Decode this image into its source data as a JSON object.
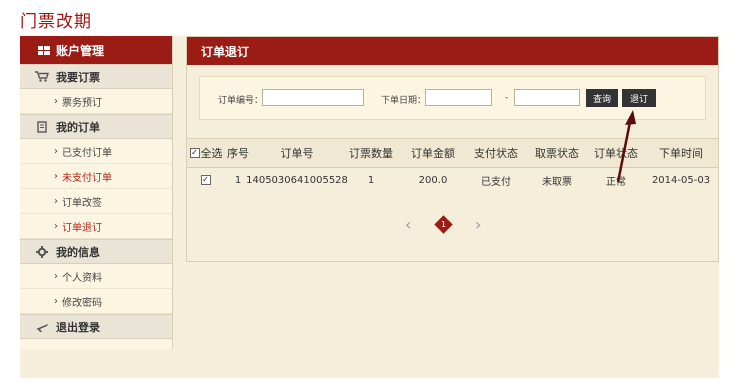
{
  "page_title": "门票改期",
  "sidebar": {
    "header": "账户管理",
    "groups": [
      {
        "label": "我要订票",
        "icon": "cart-icon",
        "items": [
          {
            "label": "票务预订",
            "active": false
          }
        ]
      },
      {
        "label": "我的订单",
        "icon": "document-icon",
        "items": [
          {
            "label": "已支付订单",
            "active": false
          },
          {
            "label": "未支付订单",
            "active": true
          },
          {
            "label": "订单改签",
            "active": false
          },
          {
            "label": "订单退订",
            "active": true
          }
        ]
      },
      {
        "label": "我的信息",
        "icon": "gear-icon",
        "items": [
          {
            "label": "个人资料",
            "active": false
          },
          {
            "label": "修改密码",
            "active": false
          }
        ]
      }
    ],
    "logout": "退出登录"
  },
  "main": {
    "header": "订单退订",
    "search": {
      "order_no_label": "订单编号：",
      "order_no_value": "",
      "date_label": "下单日期：",
      "date_from": "",
      "date_sep": "-",
      "date_to": "",
      "query_button": "查询",
      "refund_button": "退订"
    },
    "table": {
      "select_all": "全选",
      "columns": [
        "序号",
        "订单号",
        "订票数量",
        "订单金额",
        "支付状态",
        "取票状态",
        "订单状态",
        "下单时间"
      ],
      "rows": [
        {
          "checked": true,
          "cells": [
            "1",
            "1405030641005528",
            "1",
            "200.0",
            "已支付",
            "未取票",
            "正常",
            "2014-05-03"
          ]
        }
      ]
    },
    "pagination": {
      "prev": "‹",
      "current": "1",
      "next": "›"
    }
  },
  "colors": {
    "brand_red": "#9a1c14",
    "title_red": "#a31512",
    "panel_bg": "#f5eedb"
  }
}
